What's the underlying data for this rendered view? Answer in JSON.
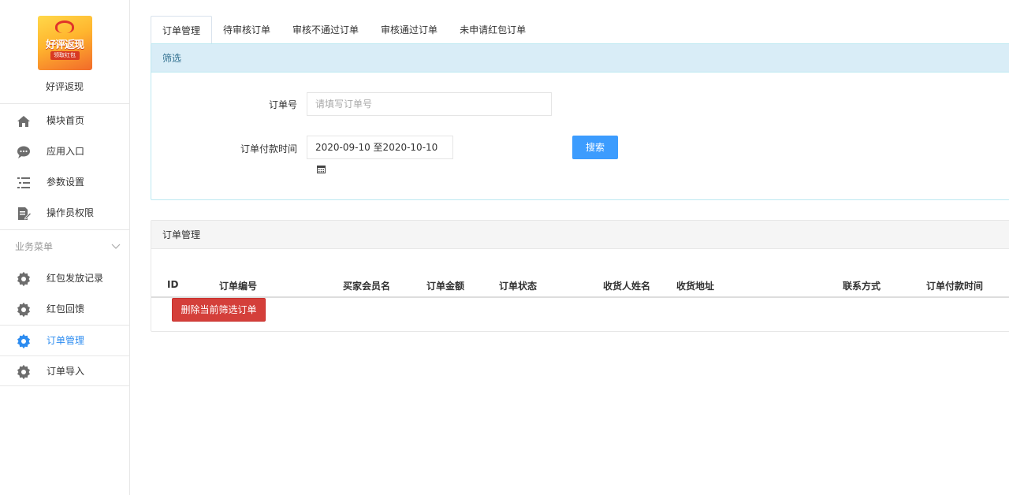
{
  "brand": {
    "name": "好评返现",
    "logo_text": "好评返现",
    "logo_subtext": "领取红包"
  },
  "menu_top": [
    {
      "label": "模块首页",
      "icon": "home-icon"
    },
    {
      "label": "应用入口",
      "icon": "chat-icon"
    },
    {
      "label": "参数设置",
      "icon": "list-icon"
    },
    {
      "label": "操作员权限",
      "icon": "edit-document-icon"
    }
  ],
  "section": {
    "title": "业务菜单"
  },
  "menu_business": [
    {
      "label": "红包发放记录",
      "icon": "gear-icon"
    },
    {
      "label": "红包回馈",
      "icon": "gear-icon"
    },
    {
      "label": "订单管理",
      "icon": "gear-icon",
      "active": true
    },
    {
      "label": "订单导入",
      "icon": "gear-icon"
    }
  ],
  "tabs": [
    "订单管理",
    "待审核订单",
    "审核不通过订单",
    "审核通过订单",
    "未申请红包订单"
  ],
  "filter": {
    "title": "筛选",
    "order_no_label": "订单号",
    "order_no_placeholder": "请填写订单号",
    "order_no_value": "",
    "paytime_label": "订单付款时间",
    "paytime_value": "2020-09-10 至2020-10-10",
    "search_label": "搜索"
  },
  "orders": {
    "title": "订单管理",
    "columns": [
      "ID",
      "订单编号",
      "买家会员名",
      "订单金额",
      "订单状态",
      "收货人姓名",
      "收货地址",
      "联系方式",
      "订单付款时间"
    ],
    "delete_label": "删除当前筛选订单"
  },
  "colors": {
    "accent": "#2d8cf0",
    "search_button": "#3c9cfe",
    "danger": "#d43f3a",
    "info_bg": "#d9edf7"
  }
}
